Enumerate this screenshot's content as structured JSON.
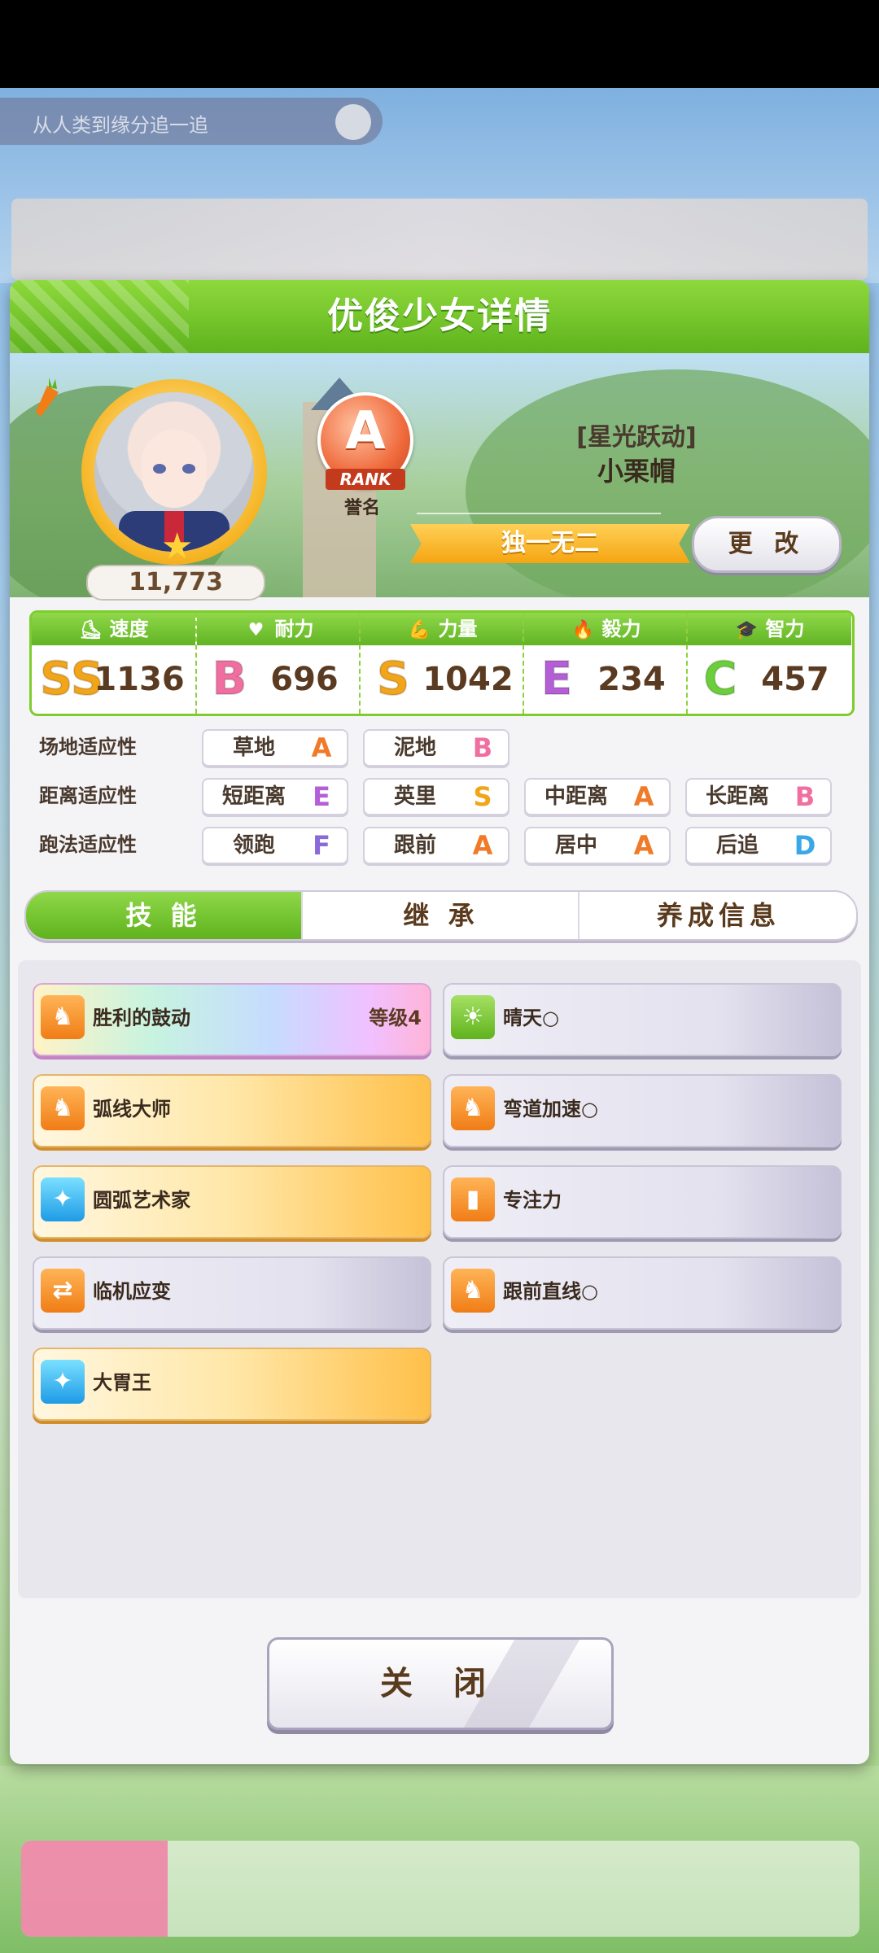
{
  "background": {
    "banner_text": "从人类到缘分追一追"
  },
  "modal": {
    "title": "优俊少女详情",
    "fans": "11,773",
    "rank": {
      "letter": "A",
      "ribbon": "RANK",
      "caption": "誉名"
    },
    "epithet": "[星光跃动]",
    "name": "小栗帽",
    "title_banner": "独一无二",
    "change_label": "更 改"
  },
  "stats": [
    {
      "label": "速度",
      "icon": "shoe-icon",
      "grade": "SS",
      "value": "1136",
      "color": "#f3a51a"
    },
    {
      "label": "耐力",
      "icon": "heart-icon",
      "grade": "B",
      "value": "696",
      "color": "#f06fa0"
    },
    {
      "label": "力量",
      "icon": "muscle-icon",
      "grade": "S",
      "value": "1042",
      "color": "#f3a51a"
    },
    {
      "label": "毅力",
      "icon": "flame-icon",
      "grade": "E",
      "value": "234",
      "color": "#b45fd6"
    },
    {
      "label": "智力",
      "icon": "graduation-cap-icon",
      "grade": "C",
      "value": "457",
      "color": "#6bcf3a"
    }
  ],
  "aptitudes": {
    "track": {
      "label": "场地适应性",
      "items": [
        {
          "name": "草地",
          "grade": "A"
        },
        {
          "name": "泥地",
          "grade": "B"
        }
      ]
    },
    "distance": {
      "label": "距离适应性",
      "items": [
        {
          "name": "短距离",
          "grade": "E"
        },
        {
          "name": "英里",
          "grade": "S"
        },
        {
          "name": "中距离",
          "grade": "A"
        },
        {
          "name": "长距离",
          "grade": "B"
        }
      ]
    },
    "style": {
      "label": "跑法适应性",
      "items": [
        {
          "name": "领跑",
          "grade": "F"
        },
        {
          "name": "跟前",
          "grade": "A"
        },
        {
          "name": "居中",
          "grade": "A"
        },
        {
          "name": "后追",
          "grade": "D"
        }
      ]
    }
  },
  "grade_colors": {
    "SS": "#f3a51a",
    "S": "#f3a51a",
    "A": "#f07a28",
    "B": "#f06fa0",
    "C": "#6bcf3a",
    "D": "#3aa8e8",
    "E": "#b45fd6",
    "F": "#8a6ad6"
  },
  "tabs": [
    "技 能",
    "继 承",
    "养成信息"
  ],
  "skills": [
    {
      "name": "胜利的鼓动",
      "level": "等级4",
      "style": "rainbow",
      "icon": "running-horse-icon",
      "icon_color": "orange"
    },
    {
      "name": "晴天○",
      "level": "",
      "style": "gray",
      "icon": "sun-icon",
      "icon_color": "green"
    },
    {
      "name": "弧线大师",
      "level": "",
      "style": "gold",
      "icon": "running-horse-icon",
      "icon_color": "orange"
    },
    {
      "name": "弯道加速○",
      "level": "",
      "style": "gray",
      "icon": "running-horse-icon",
      "icon_color": "orange"
    },
    {
      "name": "圆弧艺术家",
      "level": "",
      "style": "gold",
      "icon": "sparkle-icon",
      "icon_color": "blue"
    },
    {
      "name": "专注力",
      "level": "",
      "style": "gray",
      "icon": "starting-gate-icon",
      "icon_color": "orange"
    },
    {
      "name": "临机应变",
      "level": "",
      "style": "gray",
      "icon": "swap-icon",
      "icon_color": "orange"
    },
    {
      "name": "跟前直线○",
      "level": "",
      "style": "gray",
      "icon": "running-horse-icon",
      "icon_color": "orange"
    },
    {
      "name": "大胃王",
      "level": "",
      "style": "gold",
      "icon": "sparkle-icon",
      "icon_color": "blue"
    }
  ],
  "close_label": "关 闭"
}
